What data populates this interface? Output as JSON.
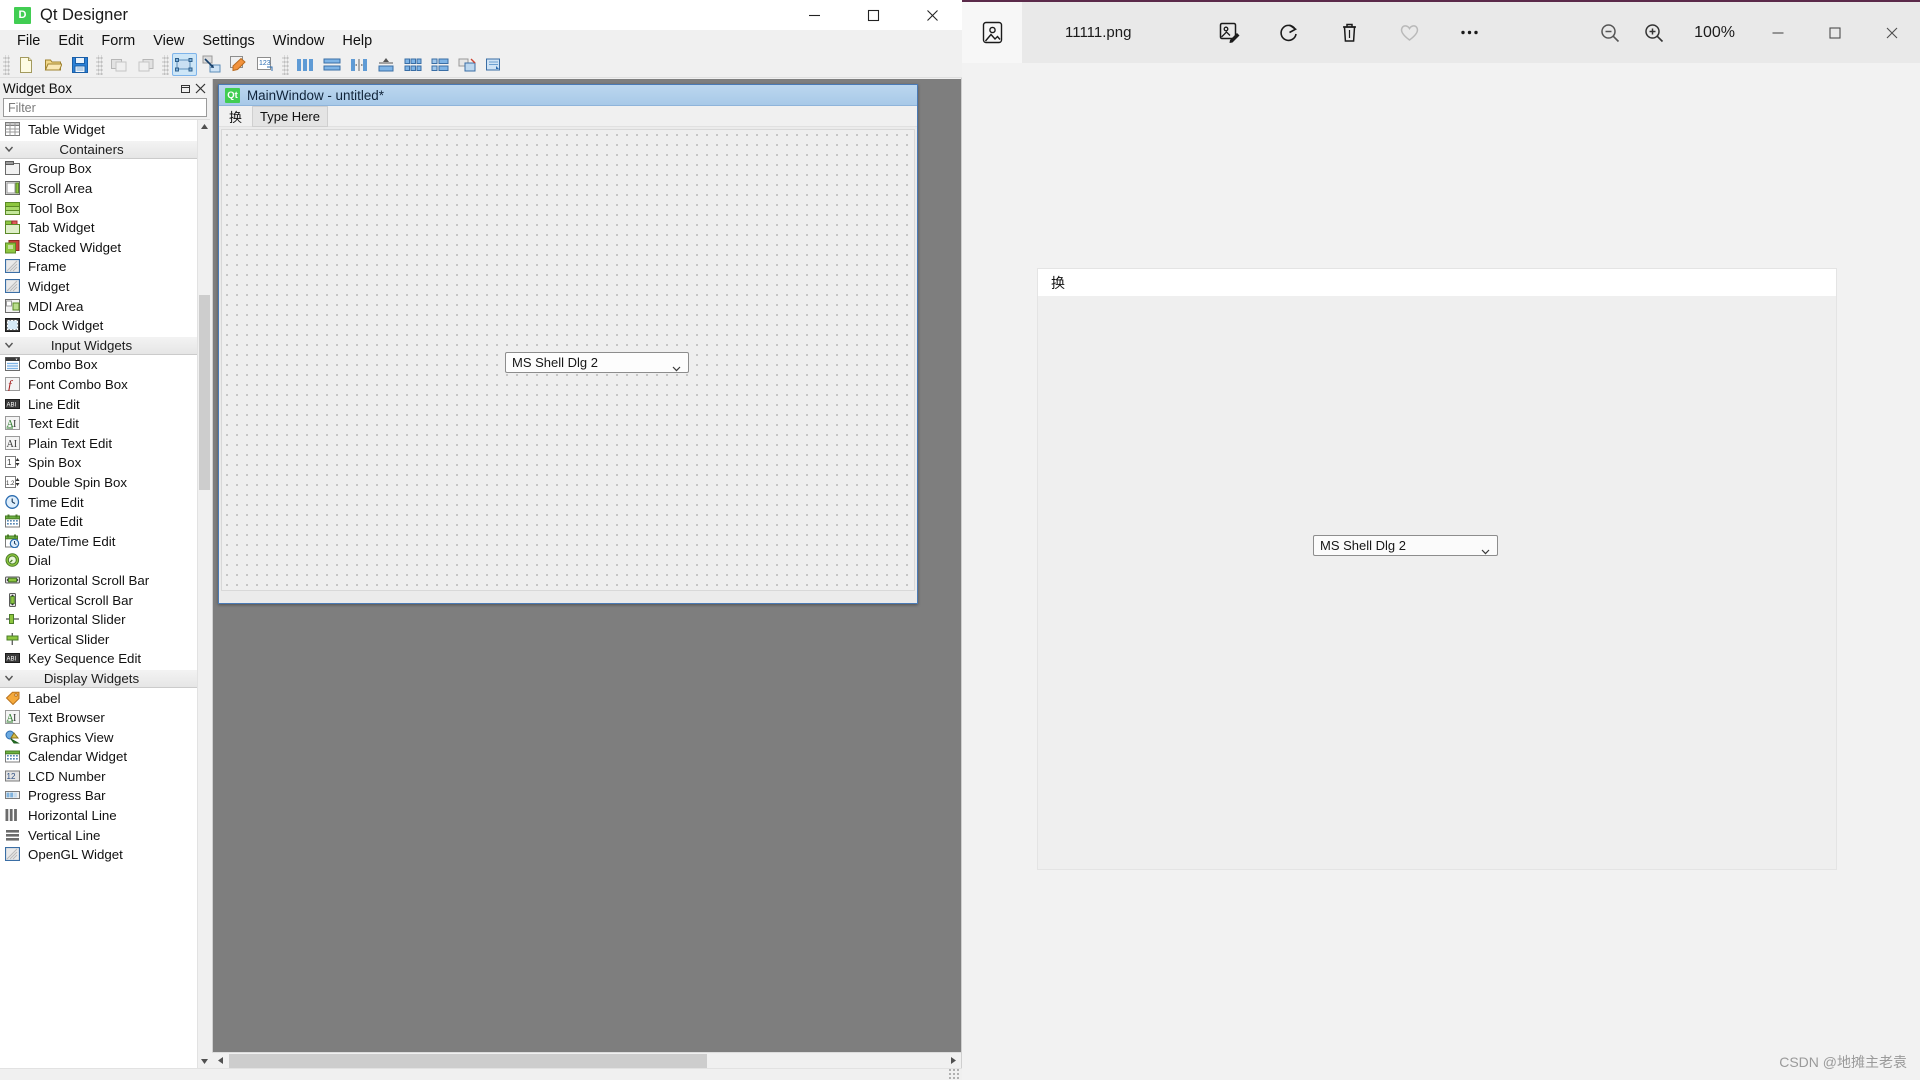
{
  "qt_designer": {
    "window_title": "Qt Designer",
    "logo_text": "D",
    "window_controls": [
      {
        "name": "minimize",
        "label": "—"
      },
      {
        "name": "maximize",
        "label": "□"
      },
      {
        "name": "close",
        "label": "✕"
      }
    ],
    "menubar": [
      "File",
      "Edit",
      "Form",
      "View",
      "Settings",
      "Window",
      "Help"
    ],
    "toolbar_groups": [
      {
        "name": "file",
        "buttons": [
          {
            "name": "new-form-button",
            "icon": "new-file-icon",
            "active": false
          },
          {
            "name": "open-form-button",
            "icon": "open-folder-icon",
            "active": false
          },
          {
            "name": "save-form-button",
            "icon": "save-disk-icon",
            "active": false
          }
        ]
      },
      {
        "name": "edit",
        "buttons": [
          {
            "name": "undo-button",
            "icon": "undo-icon",
            "active": false
          },
          {
            "name": "redo-button",
            "icon": "redo-icon",
            "active": false
          }
        ]
      },
      {
        "name": "mode",
        "buttons": [
          {
            "name": "edit-widgets-button",
            "icon": "edit-widgets-icon",
            "active": true
          },
          {
            "name": "edit-signals-slots-button",
            "icon": "signals-slots-icon",
            "active": false
          },
          {
            "name": "edit-buddies-button",
            "icon": "edit-buddies-icon",
            "active": false
          },
          {
            "name": "edit-tab-order-button",
            "icon": "tab-order-icon",
            "active": false
          }
        ]
      },
      {
        "name": "layout",
        "buttons": [
          {
            "name": "layout-horizontally-button",
            "icon": "layout-horizontal-icon",
            "active": false
          },
          {
            "name": "layout-vertically-button",
            "icon": "layout-vertical-icon",
            "active": false
          },
          {
            "name": "layout-in-splitter-horizontal-button",
            "icon": "splitter-horizontal-icon",
            "active": false
          },
          {
            "name": "layout-in-splitter-vertical-button",
            "icon": "splitter-vertical-icon",
            "active": false
          },
          {
            "name": "layout-in-grid-button",
            "icon": "layout-grid-icon",
            "active": false
          },
          {
            "name": "layout-in-form-button",
            "icon": "layout-form-icon",
            "active": false
          },
          {
            "name": "break-layout-button",
            "icon": "break-layout-icon",
            "active": false
          },
          {
            "name": "adjust-size-button",
            "icon": "adjust-size-icon",
            "active": false
          }
        ]
      }
    ],
    "widget_box": {
      "title": "Widget Box",
      "float_button": "float-icon",
      "close_button": "close-icon",
      "filter_placeholder": "Filter",
      "filter_value": "",
      "items": [
        {
          "type": "widget",
          "label": "Table Widget",
          "icon": "table-widget-icon"
        },
        {
          "type": "category",
          "label": "Containers",
          "expanded": true
        },
        {
          "type": "widget",
          "label": "Group Box",
          "icon": "group-box-icon"
        },
        {
          "type": "widget",
          "label": "Scroll Area",
          "icon": "scroll-area-icon"
        },
        {
          "type": "widget",
          "label": "Tool Box",
          "icon": "tool-box-icon"
        },
        {
          "type": "widget",
          "label": "Tab Widget",
          "icon": "tab-widget-icon"
        },
        {
          "type": "widget",
          "label": "Stacked Widget",
          "icon": "stacked-widget-icon"
        },
        {
          "type": "widget",
          "label": "Frame",
          "icon": "frame-icon"
        },
        {
          "type": "widget",
          "label": "Widget",
          "icon": "widget-icon"
        },
        {
          "type": "widget",
          "label": "MDI Area",
          "icon": "mdi-area-icon"
        },
        {
          "type": "widget",
          "label": "Dock Widget",
          "icon": "dock-widget-icon"
        },
        {
          "type": "category",
          "label": "Input Widgets",
          "expanded": true
        },
        {
          "type": "widget",
          "label": "Combo Box",
          "icon": "combo-box-icon"
        },
        {
          "type": "widget",
          "label": "Font Combo Box",
          "icon": "font-combo-box-icon"
        },
        {
          "type": "widget",
          "label": "Line Edit",
          "icon": "line-edit-icon"
        },
        {
          "type": "widget",
          "label": "Text Edit",
          "icon": "text-edit-icon"
        },
        {
          "type": "widget",
          "label": "Plain Text Edit",
          "icon": "plain-text-edit-icon"
        },
        {
          "type": "widget",
          "label": "Spin Box",
          "icon": "spin-box-icon"
        },
        {
          "type": "widget",
          "label": "Double Spin Box",
          "icon": "double-spin-box-icon"
        },
        {
          "type": "widget",
          "label": "Time Edit",
          "icon": "time-edit-icon"
        },
        {
          "type": "widget",
          "label": "Date Edit",
          "icon": "date-edit-icon"
        },
        {
          "type": "widget",
          "label": "Date/Time Edit",
          "icon": "date-time-edit-icon"
        },
        {
          "type": "widget",
          "label": "Dial",
          "icon": "dial-icon"
        },
        {
          "type": "widget",
          "label": "Horizontal Scroll Bar",
          "icon": "horizontal-scroll-bar-icon"
        },
        {
          "type": "widget",
          "label": "Vertical Scroll Bar",
          "icon": "vertical-scroll-bar-icon"
        },
        {
          "type": "widget",
          "label": "Horizontal Slider",
          "icon": "horizontal-slider-icon"
        },
        {
          "type": "widget",
          "label": "Vertical Slider",
          "icon": "vertical-slider-icon"
        },
        {
          "type": "widget",
          "label": "Key Sequence Edit",
          "icon": "key-sequence-edit-icon"
        },
        {
          "type": "category",
          "label": "Display Widgets",
          "expanded": true
        },
        {
          "type": "widget",
          "label": "Label",
          "icon": "label-icon"
        },
        {
          "type": "widget",
          "label": "Text Browser",
          "icon": "text-browser-icon"
        },
        {
          "type": "widget",
          "label": "Graphics View",
          "icon": "graphics-view-icon"
        },
        {
          "type": "widget",
          "label": "Calendar Widget",
          "icon": "calendar-widget-icon"
        },
        {
          "type": "widget",
          "label": "LCD Number",
          "icon": "lcd-number-icon"
        },
        {
          "type": "widget",
          "label": "Progress Bar",
          "icon": "progress-bar-icon"
        },
        {
          "type": "widget",
          "label": "Horizontal Line",
          "icon": "horizontal-line-icon"
        },
        {
          "type": "widget",
          "label": "Vertical Line",
          "icon": "vertical-line-icon"
        },
        {
          "type": "widget",
          "label": "OpenGL Widget",
          "icon": "opengl-widget-icon"
        }
      ]
    },
    "form": {
      "title": "MainWindow - untitled*",
      "logo_text": "Qt",
      "menubar": [
        {
          "label": "换",
          "active": false
        },
        {
          "label": "Type Here",
          "active": true
        }
      ],
      "combo_box": {
        "value": "MS Shell Dlg 2",
        "arrow": "chevron-down-icon"
      }
    }
  },
  "photos_viewer": {
    "app_icon": "photo-app-icon",
    "filename": "11111.png",
    "tools": [
      {
        "name": "edit-image-button",
        "icon": "edit-image-icon"
      },
      {
        "name": "rotate-button",
        "icon": "rotate-icon"
      },
      {
        "name": "delete-button",
        "icon": "trash-icon"
      },
      {
        "name": "favorite-button",
        "icon": "heart-icon"
      },
      {
        "name": "more-button",
        "icon": "ellipsis-icon"
      }
    ],
    "zoom_out": "zoom-out-icon",
    "zoom_in": "zoom-in-icon",
    "zoom_level": "100%",
    "window_controls": [
      {
        "name": "minimize",
        "label": "—"
      },
      {
        "name": "maximize",
        "label": "□"
      },
      {
        "name": "close",
        "label": "✕"
      }
    ],
    "image_content": {
      "menubar_label": "换",
      "combo_box": {
        "value": "MS Shell Dlg 2",
        "arrow": "chevron-down-icon"
      }
    }
  },
  "watermark": "CSDN @地摊主老袁"
}
